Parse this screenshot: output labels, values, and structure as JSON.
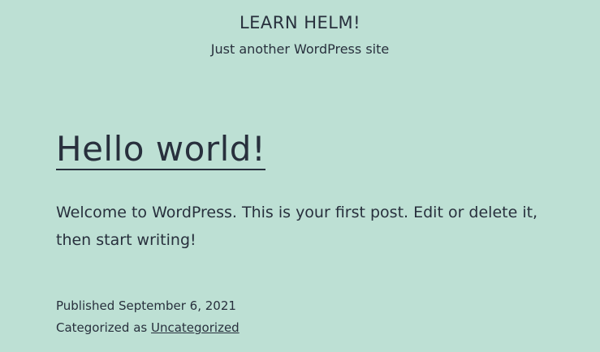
{
  "header": {
    "site_title": "LEARN HELM!",
    "site_description": "Just another WordPress site"
  },
  "post": {
    "title": "Hello world!",
    "content": "Welcome to WordPress. This is your first post. Edit or delete it, then start writing!",
    "published_label": "Published",
    "published_date": "September 6, 2021",
    "categorized_label": "Categorized as",
    "category": "Uncategorized"
  },
  "colors": {
    "background": "#bde0d4",
    "text": "#28303d"
  }
}
